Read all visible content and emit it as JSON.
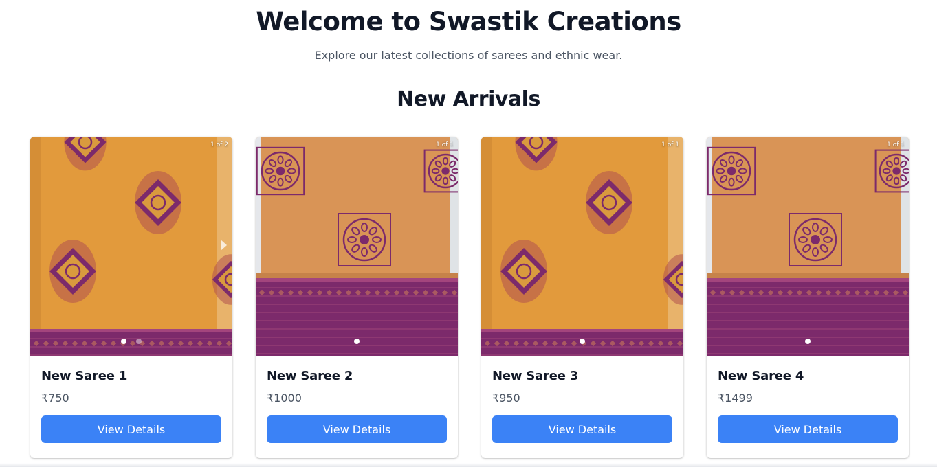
{
  "header": {
    "title": "Welcome to Swastik Creations",
    "subtitle": "Explore our latest collections of sarees and ethnic wear."
  },
  "section": {
    "title": "New Arrivals"
  },
  "colors": {
    "accent": "#3b82f6",
    "saree_orange": "#e29a3c",
    "saree_peach": "#d99456",
    "border_purple": "#7c2a6b"
  },
  "products": [
    {
      "name": "New Saree 1",
      "price": "₹750",
      "button": "View Details",
      "counter": "1 of 2",
      "slides": 2,
      "active_slide": 1,
      "has_next_arrow": true,
      "pattern": "ikat"
    },
    {
      "name": "New Saree 2",
      "price": "₹1000",
      "button": "View Details",
      "counter": "1 of 1",
      "slides": 1,
      "active_slide": 1,
      "has_next_arrow": false,
      "pattern": "mandala"
    },
    {
      "name": "New Saree 3",
      "price": "₹950",
      "button": "View Details",
      "counter": "1 of 1",
      "slides": 1,
      "active_slide": 1,
      "has_next_arrow": false,
      "pattern": "ikat"
    },
    {
      "name": "New Saree 4",
      "price": "₹1499",
      "button": "View Details",
      "counter": "1 of 1",
      "slides": 1,
      "active_slide": 1,
      "has_next_arrow": false,
      "pattern": "mandala"
    }
  ]
}
